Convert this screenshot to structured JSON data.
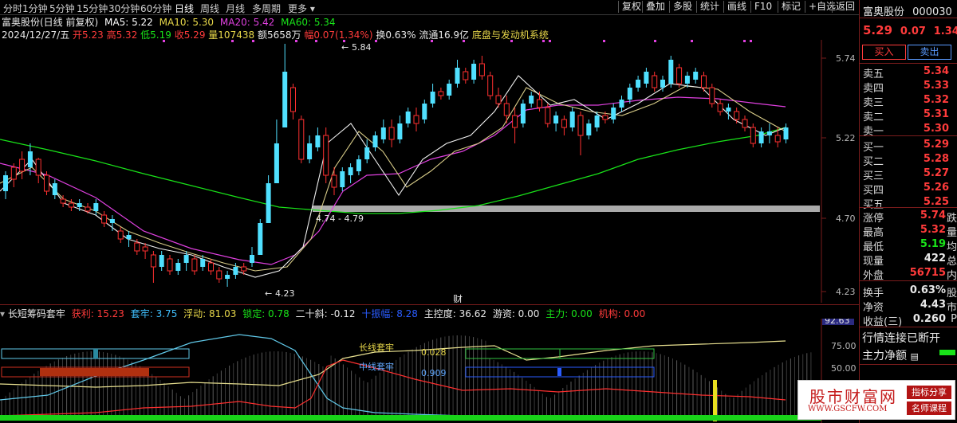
{
  "periods": [
    "分时",
    "1分钟",
    "5分钟",
    "15分钟",
    "30分钟",
    "60分钟",
    "日线",
    "周线",
    "月线",
    "多周期",
    "更多"
  ],
  "toolbar": [
    "复权",
    "叠加",
    "多股",
    "统计",
    "画线",
    "F10",
    "标记",
    "+自选",
    "返回"
  ],
  "stock": {
    "name": "富奥股份",
    "code": "000030",
    "price": "5.29",
    "change": "0.07",
    "pct": "1.34%"
  },
  "chart_title": "富奥股份(日线 前复权)",
  "ma_labels": [
    {
      "text": "MA5: 5.22",
      "color": "#ffffff"
    },
    {
      "text": "MA10: 5.30",
      "color": "#e8d84a"
    },
    {
      "text": "MA20: 5.42",
      "color": "#e040e0"
    },
    {
      "text": "MA60: 5.34",
      "color": "#19e319"
    }
  ],
  "ohlc": {
    "date": "2024/12/27/五",
    "open": "开5.23",
    "high": "高5.32",
    "low": "低5.19",
    "close": "收5.29",
    "vol": "量107438",
    "amt": "额5658万",
    "amp": "幅0.07(1.34%)",
    "turnover": "换0.63%",
    "float": "流通16.9亿",
    "sector": "底盘与发动机系统"
  },
  "price_axis": [
    "5.74",
    "5.22",
    "4.70",
    "4.23"
  ],
  "annotations": {
    "high": "5.84",
    "low": "4.23",
    "range": "4.74 - 4.79",
    "finance": "财"
  },
  "buttons": {
    "buy": "买入",
    "sell": "卖出"
  },
  "orderbook": [
    {
      "label": "卖五",
      "price": "5.34"
    },
    {
      "label": "卖四",
      "price": "5.33"
    },
    {
      "label": "卖三",
      "price": "5.32"
    },
    {
      "label": "卖二",
      "price": "5.31"
    },
    {
      "label": "卖一",
      "price": "5.30"
    },
    {
      "label": "买一",
      "price": "5.29"
    },
    {
      "label": "买二",
      "price": "5.28"
    },
    {
      "label": "买三",
      "price": "5.27"
    },
    {
      "label": "买四",
      "price": "5.26"
    },
    {
      "label": "买五",
      "price": "5.25"
    }
  ],
  "stats": [
    {
      "label": "涨停",
      "value": "5.74",
      "tail": "跌",
      "color": "#ff3b3b"
    },
    {
      "label": "最高",
      "value": "5.32",
      "tail": "量",
      "color": "#ff3b3b"
    },
    {
      "label": "最低",
      "value": "5.19",
      "tail": "均",
      "color": "#19e319"
    },
    {
      "label": "现量",
      "value": "422",
      "tail": "总",
      "color": "#e8e8e8"
    },
    {
      "label": "外盘",
      "value": "56715",
      "tail": "内",
      "color": "#ff3b3b"
    },
    {
      "label": "换手",
      "value": "0.63%",
      "tail": "股",
      "color": "#e8e8e8"
    },
    {
      "label": "净资",
      "value": "4.43",
      "tail": "市",
      "color": "#e8e8e8"
    },
    {
      "label": "收益(三)",
      "value": "0.260",
      "tail": "P",
      "color": "#e8e8e8"
    }
  ],
  "status": {
    "conn": "行情连接已断开",
    "flow": "主力净额"
  },
  "indicator": {
    "name": "长短筹码套牢",
    "items": [
      {
        "text": "获利: 15.23",
        "color": "#ff3b3b"
      },
      {
        "text": "套牢: 3.75",
        "color": "#40c0ff"
      },
      {
        "text": "浮动: 81.03",
        "color": "#e8d84a"
      },
      {
        "text": "锁定: 0.78",
        "color": "#19e319"
      },
      {
        "text": "二十斜: -0.12",
        "color": "#e8e8e8"
      },
      {
        "text": "十振幅: 8.28",
        "color": "#2a5cff"
      },
      {
        "text": "主控度: 36.62",
        "color": "#e8e8e8"
      },
      {
        "text": "游资: 0.00",
        "color": "#e8e8e8"
      },
      {
        "text": "主力: 0.00",
        "color": "#19e319"
      },
      {
        "text": "机构: 0.00",
        "color": "#ff3b3b"
      }
    ],
    "axis": [
      "92.63",
      "75.00",
      "50.00"
    ],
    "long_label": "长线套牢",
    "long_val": "0.028",
    "mid_label": "中线套牢",
    "mid_val": "0.909"
  },
  "watermark": {
    "main": "股市财富网",
    "sub": "WWW.GSCFW.COM",
    "tag1": "指标分享",
    "tag2": "名师课程"
  }
}
